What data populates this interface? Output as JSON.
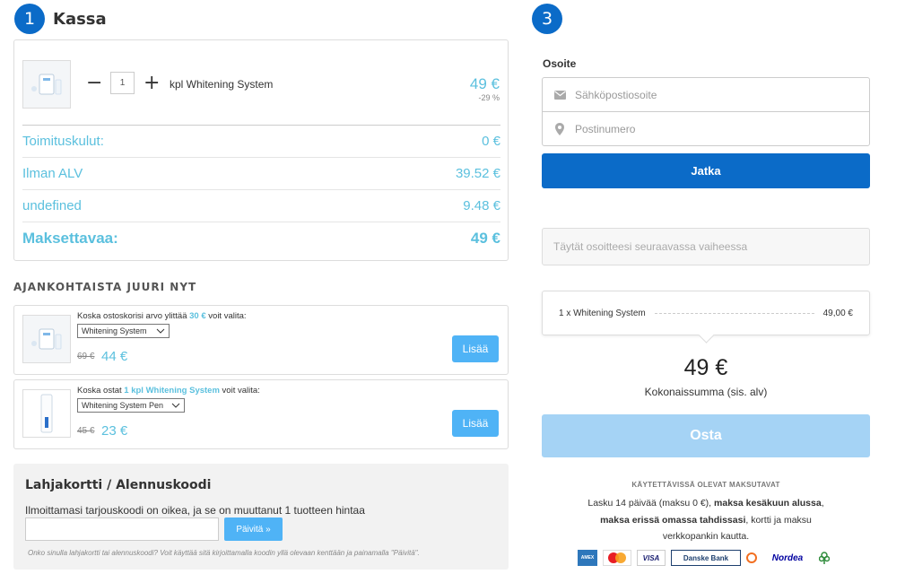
{
  "steps": {
    "step1_number": "1",
    "step1_title": "Kassa",
    "step3_number": "3"
  },
  "cart": {
    "product": {
      "quantity": "1",
      "name": "kpl Whitening System",
      "price": "49 €",
      "discount": "-29 %"
    },
    "summary": [
      {
        "label": "Toimituskulut:",
        "value": "0 €"
      },
      {
        "label": "Ilman ALV",
        "value": "39.52 €"
      },
      {
        "label": "undefined",
        "value": "9.48 €"
      }
    ],
    "total": {
      "label": "Maksettavaa:",
      "value": "49 €"
    }
  },
  "offers": {
    "heading": "AJANKOHTAISTA JUURI NYT",
    "items": [
      {
        "text_before": "Koska ostoskorisi arvo ylittää ",
        "highlight": "30 €",
        "text_after": " voit valita:",
        "select_value": "Whitening System",
        "old_price": "69 €",
        "new_price": "44 €",
        "button": "Lisää"
      },
      {
        "text_before": "Koska ostat ",
        "highlight": "1 kpl Whitening System",
        "text_after": " voit valita:",
        "select_value": "Whitening System Pen",
        "old_price": "45 €",
        "new_price": "23 €",
        "button": "Lisää"
      }
    ]
  },
  "gift": {
    "title": "Lahjakortti / Alennuskoodi",
    "message": "Ilmoittamasi tarjouskoodi on oikea, ja se on muuttanut 1 tuotteen hintaa",
    "input_value": "",
    "button": "Päivitä »",
    "note": "Onko sinulla lahjakortti tai alennuskoodi? Voit käyttää sitä kirjoittamalla koodin yllä olevaan kenttään ja painamalla \"Päivitä\"."
  },
  "address": {
    "label": "Osoite",
    "email_placeholder": "Sähköpostiosoite",
    "zip_placeholder": "Postinumero",
    "continue_button": "Jatka",
    "next_step_note": "Täytät osoitteesi seuraavassa vaiheessa"
  },
  "order": {
    "line_item": "1 x Whitening System",
    "line_price": "49,00 €",
    "total_amount": "49 €",
    "total_label": "Kokonaissumma (sis. alv)",
    "buy_button": "Osta"
  },
  "payment": {
    "heading": "KÄYTETTÄVISSÄ OLEVAT MAKSUTAVAT",
    "line1_plain": "Lasku 14 päivää (maksu 0 €), ",
    "line1_bold": "maksa kesäkuun alussa",
    "line1_end": ",",
    "line2_bold": "maksa erissä omassa tahdissasi",
    "line2_plain": ", kortti ja maksu",
    "line3_plain": "verkkopankin kautta.",
    "logos": [
      "AMEX",
      "MasterCard",
      "VISA",
      "Danske Bank",
      "Nordea"
    ]
  },
  "colors": {
    "primary_blue": "#0b6bc8",
    "accent_cyan": "#5bc0de",
    "button_light": "#4fb3f6",
    "buy_disabled": "#a5d3f5"
  }
}
